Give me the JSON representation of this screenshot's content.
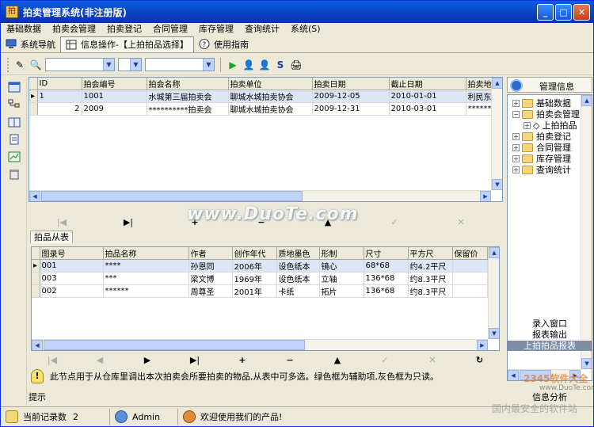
{
  "window": {
    "title": "拍卖管理系统(非注册版)"
  },
  "menu": [
    "基础数据",
    "拍卖会管理",
    "拍卖登记",
    "合同管理",
    "库存管理",
    "查询统计",
    "系统(S)"
  ],
  "tabs": [
    {
      "label": "系统导航"
    },
    {
      "label": "信息操作-【上拍拍品选择】"
    },
    {
      "label": "使用指南"
    }
  ],
  "grid1": {
    "columns": [
      "ID",
      "拍会编号",
      "拍会名称",
      "拍卖单位",
      "拍卖日期",
      "截止日期",
      "拍卖地"
    ],
    "rows": [
      [
        "1",
        "1001",
        "水城第三届拍卖会",
        "聊城水城拍卖协会",
        "2009-12-05",
        "2010-01-01",
        "利民东"
      ],
      [
        "2",
        "2009",
        "**********拍卖会",
        "聊城水城拍卖协会",
        "2009-12-31",
        "2010-03-01",
        "******"
      ]
    ]
  },
  "subtab": {
    "label": "拍品从表"
  },
  "grid2": {
    "columns": [
      "图录号",
      "拍品名称",
      "作者",
      "创作年代",
      "质地墨色",
      "形制",
      "尺寸",
      "平方尺",
      "保留价"
    ],
    "rows": [
      [
        "001",
        "****",
        "孙恩同",
        "2006年",
        "设色纸本",
        "镜心",
        "68*68",
        "约4.2平尺",
        ""
      ],
      [
        "003",
        "***",
        "梁文博",
        "1969年",
        "设色纸本",
        "立轴",
        "136*68",
        "约8.3平尺",
        ""
      ],
      [
        "002",
        "******",
        "周尊圣",
        "2001年",
        "卡纸",
        "拓片",
        "136*68",
        "约8.3平尺",
        ""
      ]
    ]
  },
  "tip": {
    "text": "此节点用于从仓库里调出本次拍卖会所要拍卖的物品,从表中可多选。绿色框为辅助项,灰色框为只读。",
    "label": "提示"
  },
  "right_panel": {
    "title": "管理信息",
    "tree": [
      {
        "label": "基础数据",
        "level": 0,
        "expanded": false
      },
      {
        "label": "拍卖会管理",
        "level": 0,
        "expanded": true
      },
      {
        "label": "上拍拍品",
        "level": 1,
        "expanded": false
      },
      {
        "label": "拍卖登记",
        "level": 0,
        "expanded": false
      },
      {
        "label": "合同管理",
        "level": 0,
        "expanded": false
      },
      {
        "label": "库存管理",
        "level": 0,
        "expanded": false
      },
      {
        "label": "查询统计",
        "level": 0,
        "expanded": false
      }
    ],
    "buttons": [
      "录入窗口",
      "报表输出",
      "上拍拍品报表",
      "信息分析"
    ]
  },
  "status": {
    "records_label": "当前记录数",
    "records_value": "2",
    "user": "Admin",
    "welcome": "欢迎使用我们的产品!"
  },
  "watermark": {
    "text": "www.DuoTe.com",
    "brand": "2345软件大全",
    "brand_url": "www.DuoTe.com",
    "brand_sub": "国内最安全的软件站"
  },
  "colors": {
    "titlebar": "#0a4fd0",
    "accent": "#c1d3fb",
    "tree_selected": "#7f8fa8"
  }
}
